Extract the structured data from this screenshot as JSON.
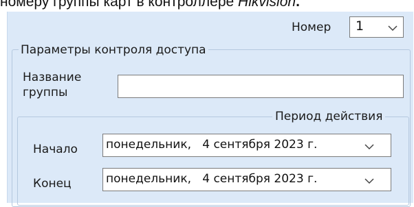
{
  "doc_text": {
    "prefix": "номеру группы карт в контроллере ",
    "italic": "Hikvision",
    "suffix": "."
  },
  "form": {
    "number_label": "Номер",
    "number_value": "1",
    "group_title": "Параметры контроля доступа",
    "name_label_line1": "Название",
    "name_label_line2": "группы",
    "name_value": "",
    "period_title": "Период действия",
    "start_label": "Начало",
    "start_value": "понедельник,   4 сентября 2023 г.",
    "end_label": "Конец",
    "end_value": "понедельник,   4 сентября 2023 г."
  },
  "icons": {
    "dropdown": "chevron-down-icon"
  }
}
